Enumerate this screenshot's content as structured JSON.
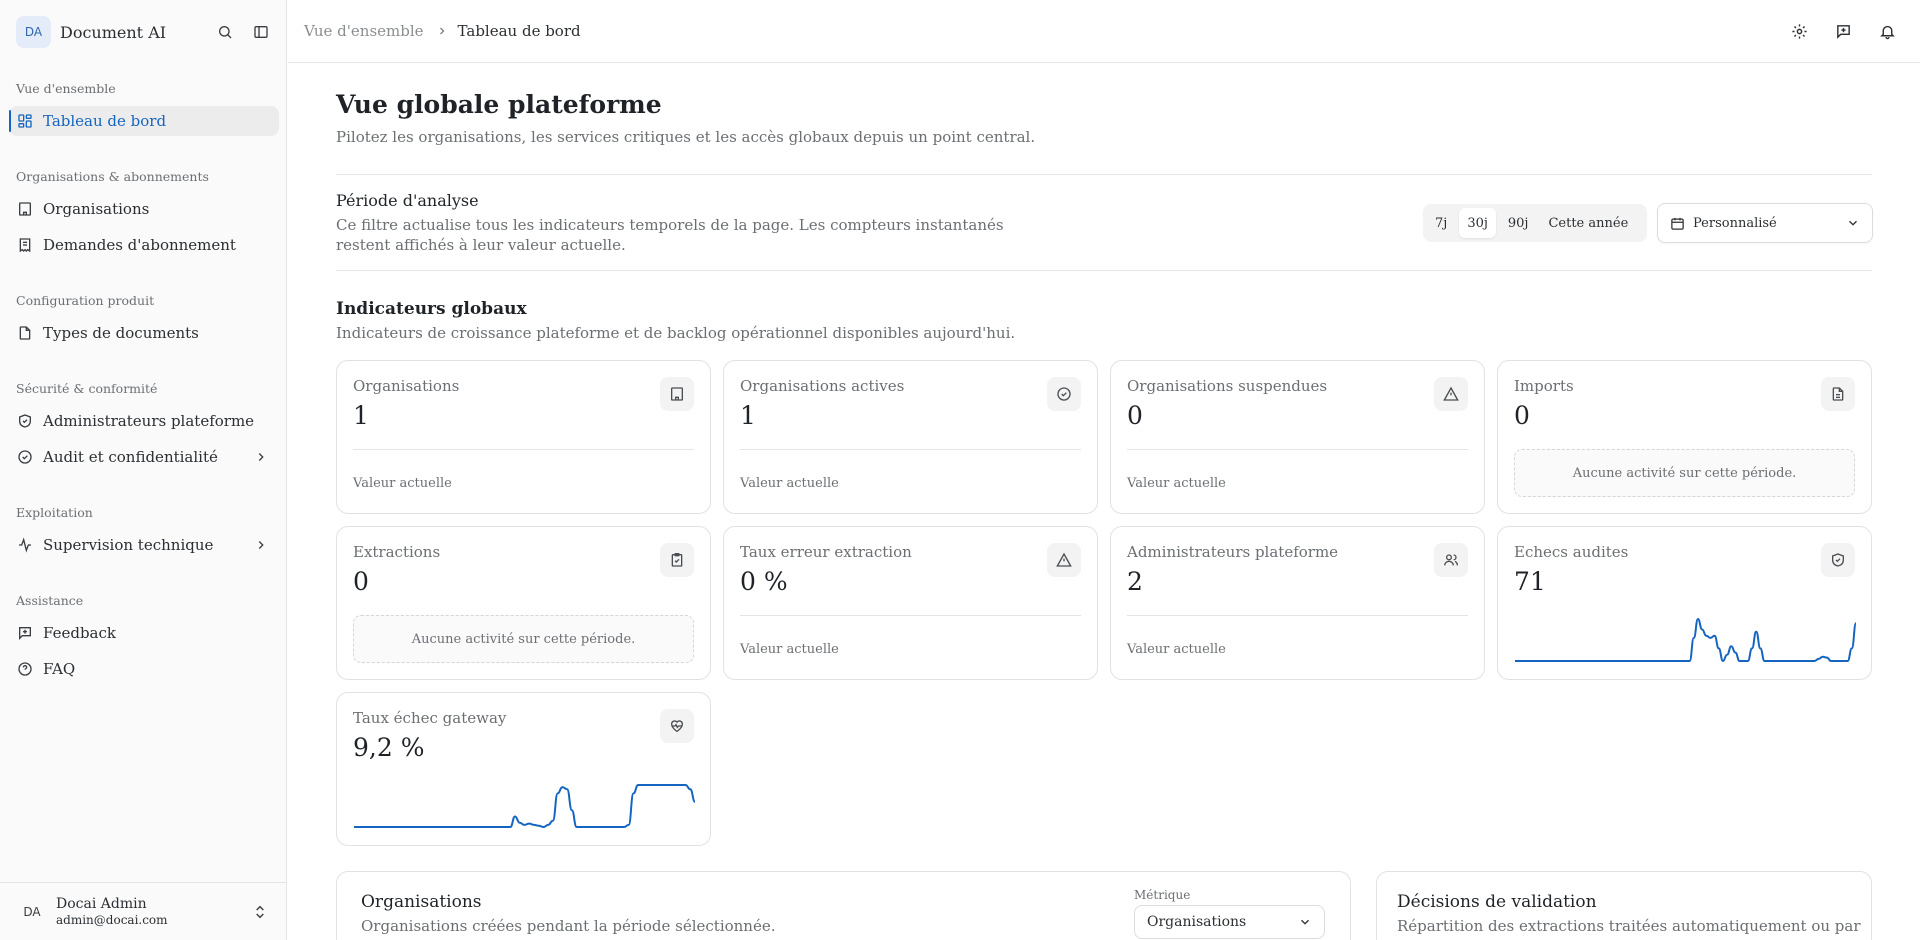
{
  "sidebar": {
    "logo_initials": "DA",
    "app_name": "Document AI",
    "sections": [
      {
        "label": "Vue d'ensemble",
        "items": [
          {
            "label": "Tableau de bord",
            "icon": "dashboard-grid-icon",
            "active": true
          }
        ]
      },
      {
        "label": "Organisations & abonnements",
        "items": [
          {
            "label": "Organisations",
            "icon": "building-icon"
          },
          {
            "label": "Demandes d'abonnement",
            "icon": "receipt-icon"
          }
        ]
      },
      {
        "label": "Configuration produit",
        "items": [
          {
            "label": "Types de documents",
            "icon": "file-icon"
          }
        ]
      },
      {
        "label": "Sécurité & conformité",
        "items": [
          {
            "label": "Administrateurs plateforme",
            "icon": "shield-check-icon"
          },
          {
            "label": "Audit et confidentialité",
            "icon": "circle-check-icon",
            "has_submenu": true
          }
        ]
      },
      {
        "label": "Exploitation",
        "items": [
          {
            "label": "Supervision technique",
            "icon": "activity-icon",
            "has_submenu": true
          }
        ]
      },
      {
        "label": "Assistance",
        "items": [
          {
            "label": "Feedback",
            "icon": "message-plus-icon"
          },
          {
            "label": "FAQ",
            "icon": "help-circle-icon"
          }
        ]
      }
    ],
    "user": {
      "initials": "DA",
      "name": "Docai Admin",
      "email": "admin@docai.com"
    }
  },
  "breadcrumb": {
    "parent": "Vue d'ensemble",
    "current": "Tableau de bord"
  },
  "page": {
    "title": "Vue globale plateforme",
    "subtitle": "Pilotez les organisations, les services critiques et les accès globaux depuis un point central."
  },
  "period": {
    "title": "Période d'analyse",
    "description": "Ce filtre actualise tous les indicateurs temporels de la page. Les compteurs instantanés restent affichés à leur valeur actuelle.",
    "options": [
      "7j",
      "30j",
      "90j",
      "Cette année"
    ],
    "selected": "30j",
    "custom_label": "Personnalisé"
  },
  "indicators": {
    "title": "Indicateurs globaux",
    "subtitle": "Indicateurs de croissance plateforme et de backlog opérationnel disponibles aujourd'hui.",
    "cards": [
      {
        "title": "Organisations",
        "value": "1",
        "icon": "building-icon",
        "footer": "Valeur actuelle"
      },
      {
        "title": "Organisations actives",
        "value": "1",
        "icon": "circle-check-icon",
        "footer": "Valeur actuelle"
      },
      {
        "title": "Organisations suspendues",
        "value": "0",
        "icon": "alert-triangle-icon",
        "footer": "Valeur actuelle"
      },
      {
        "title": "Imports",
        "value": "0",
        "icon": "file-text-icon",
        "empty": "Aucune activité sur cette période."
      },
      {
        "title": "Extractions",
        "value": "0",
        "icon": "clipboard-check-icon",
        "empty": "Aucune activité sur cette période."
      },
      {
        "title": "Taux erreur extraction",
        "value": "0 %",
        "icon": "alert-triangle-icon",
        "footer": "Valeur actuelle"
      },
      {
        "title": "Administrateurs plateforme",
        "value": "2",
        "icon": "users-icon",
        "footer": "Valeur actuelle"
      },
      {
        "title": "Echecs audites",
        "value": "71",
        "icon": "shield-check-icon",
        "sparkline": [
          0,
          0,
          0,
          0,
          0,
          0,
          0,
          0,
          0,
          0,
          0,
          0,
          0,
          0,
          0,
          0,
          0,
          0,
          0,
          0,
          0,
          0,
          0,
          0,
          0,
          0,
          0,
          0,
          0,
          0,
          0,
          0,
          0,
          0,
          0,
          0,
          0,
          0,
          0,
          0,
          0,
          0,
          0,
          0.55,
          1,
          0.75,
          0.6,
          0.55,
          0.6,
          0.3,
          0,
          0.15,
          0.35,
          0.2,
          0,
          0,
          0,
          0.3,
          0.7,
          0.3,
          0,
          0,
          0,
          0,
          0,
          0,
          0,
          0,
          0,
          0,
          0,
          0,
          0,
          0.05,
          0.1,
          0.08,
          0,
          0,
          0,
          0,
          0,
          0.3,
          0.9
        ]
      },
      {
        "title": "Taux échec gateway",
        "value": "9,2 %",
        "icon": "heart-pulse-icon",
        "sparkline": [
          0,
          0,
          0,
          0,
          0,
          0,
          0,
          0,
          0,
          0,
          0,
          0,
          0,
          0,
          0,
          0,
          0,
          0,
          0,
          0,
          0,
          0,
          0,
          0,
          0,
          0,
          0,
          0,
          0,
          0,
          0,
          0,
          0,
          0,
          0.25,
          0.1,
          0.05,
          0.08,
          0.05,
          0.03,
          0,
          0.05,
          0.15,
          0.8,
          0.95,
          0.9,
          0.4,
          0,
          0,
          0,
          0,
          0,
          0,
          0,
          0,
          0,
          0,
          0,
          0.05,
          0.8,
          1,
          1,
          1,
          1,
          1,
          1,
          1,
          1,
          1,
          1,
          1,
          0.9,
          0.6
        ]
      }
    ]
  },
  "panels": {
    "organisations": {
      "title": "Organisations",
      "subtitle": "Organisations créées pendant la période sélectionnée.",
      "metric_label": "Métrique",
      "metric_value": "Organisations"
    },
    "decisions": {
      "title": "Décisions de validation",
      "subtitle": "Répartition des extractions traitées automatiquement ou par"
    }
  },
  "colors": {
    "accent": "#1565c0",
    "sparkline": "#1565c0"
  }
}
